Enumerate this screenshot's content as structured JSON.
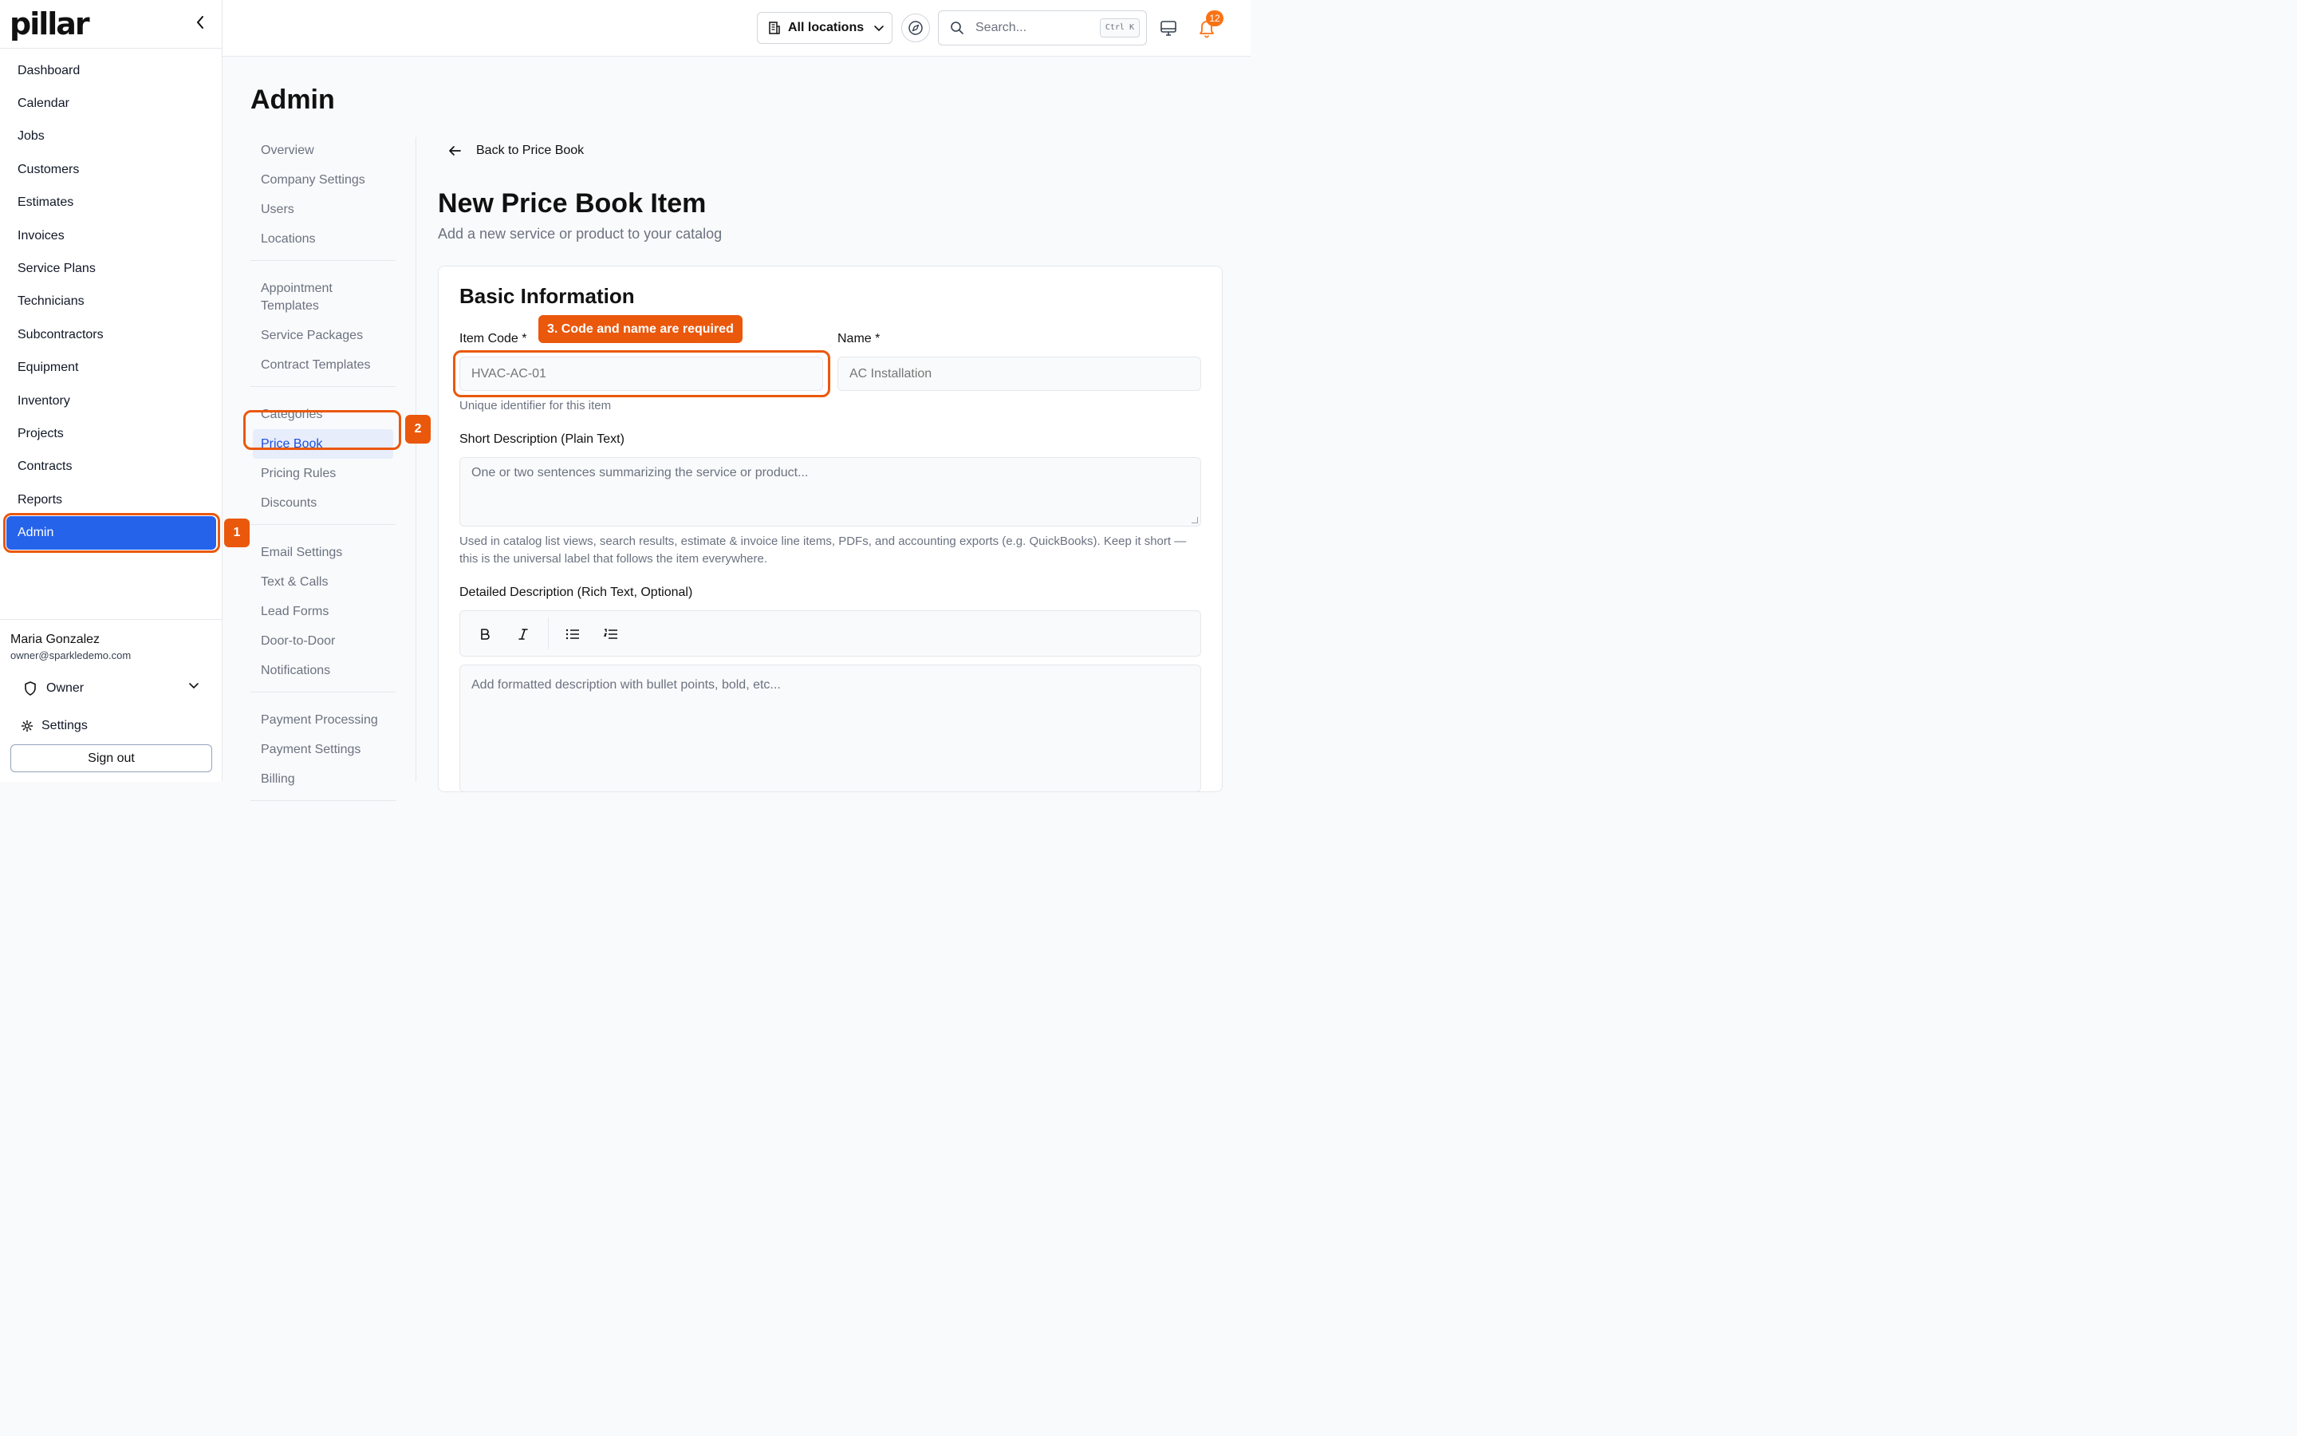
{
  "brand": {
    "logo_text": "pillar"
  },
  "sidebar": {
    "items": [
      {
        "label": "Dashboard"
      },
      {
        "label": "Calendar"
      },
      {
        "label": "Jobs"
      },
      {
        "label": "Customers"
      },
      {
        "label": "Estimates"
      },
      {
        "label": "Invoices"
      },
      {
        "label": "Service Plans"
      },
      {
        "label": "Technicians"
      },
      {
        "label": "Subcontractors"
      },
      {
        "label": "Equipment"
      },
      {
        "label": "Inventory"
      },
      {
        "label": "Projects"
      },
      {
        "label": "Contracts"
      },
      {
        "label": "Reports"
      },
      {
        "label": "Admin"
      }
    ],
    "active_item": "Admin"
  },
  "user": {
    "name": "Maria Gonzalez",
    "email": "owner@sparkledemo.com",
    "role": "Owner",
    "settings_label": "Settings",
    "signout_label": "Sign out"
  },
  "topbar": {
    "location_label": "All locations",
    "search_placeholder": "Search...",
    "search_shortcut": "Ctrl K",
    "notification_count": "12"
  },
  "admin": {
    "title": "Admin",
    "subnav_groups": [
      [
        "Overview",
        "Company Settings",
        "Users",
        "Locations"
      ],
      [
        "Appointment Templates",
        "Service Packages",
        "Contract Templates"
      ],
      [
        "Categories",
        "Price Book",
        "Pricing Rules",
        "Discounts"
      ],
      [
        "Email Settings",
        "Text & Calls",
        "Lead Forms",
        "Door-to-Door",
        "Notifications"
      ],
      [
        "Payment Processing",
        "Payment Settings",
        "Billing"
      ]
    ],
    "active_subnav": "Price Book"
  },
  "page": {
    "back_label": "Back to Price Book",
    "title": "New Price Book Item",
    "subtitle": "Add a new service or product to your catalog"
  },
  "form": {
    "section_title": "Basic Information",
    "item_code": {
      "label": "Item Code *",
      "placeholder": "HVAC-AC-01",
      "help": "Unique identifier for this item"
    },
    "name": {
      "label": "Name *",
      "placeholder": "AC Installation"
    },
    "short_description": {
      "label": "Short Description (Plain Text)",
      "placeholder": "One or two sentences summarizing the service or product...",
      "help": "Used in catalog list views, search results, estimate & invoice line items, PDFs, and accounting exports (e.g. QuickBooks). Keep it short — this is the universal label that follows the item everywhere."
    },
    "detailed_description": {
      "label": "Detailed Description (Rich Text, Optional)",
      "placeholder": "Add formatted description with bullet points, bold, etc..."
    }
  },
  "annotations": {
    "step1": "1",
    "step2": "2",
    "step3": "3. Code and name are required",
    "color": "#ea580c"
  },
  "colors": {
    "primary": "#2563eb",
    "accent": "#ea580c",
    "badge": "#f97316"
  }
}
